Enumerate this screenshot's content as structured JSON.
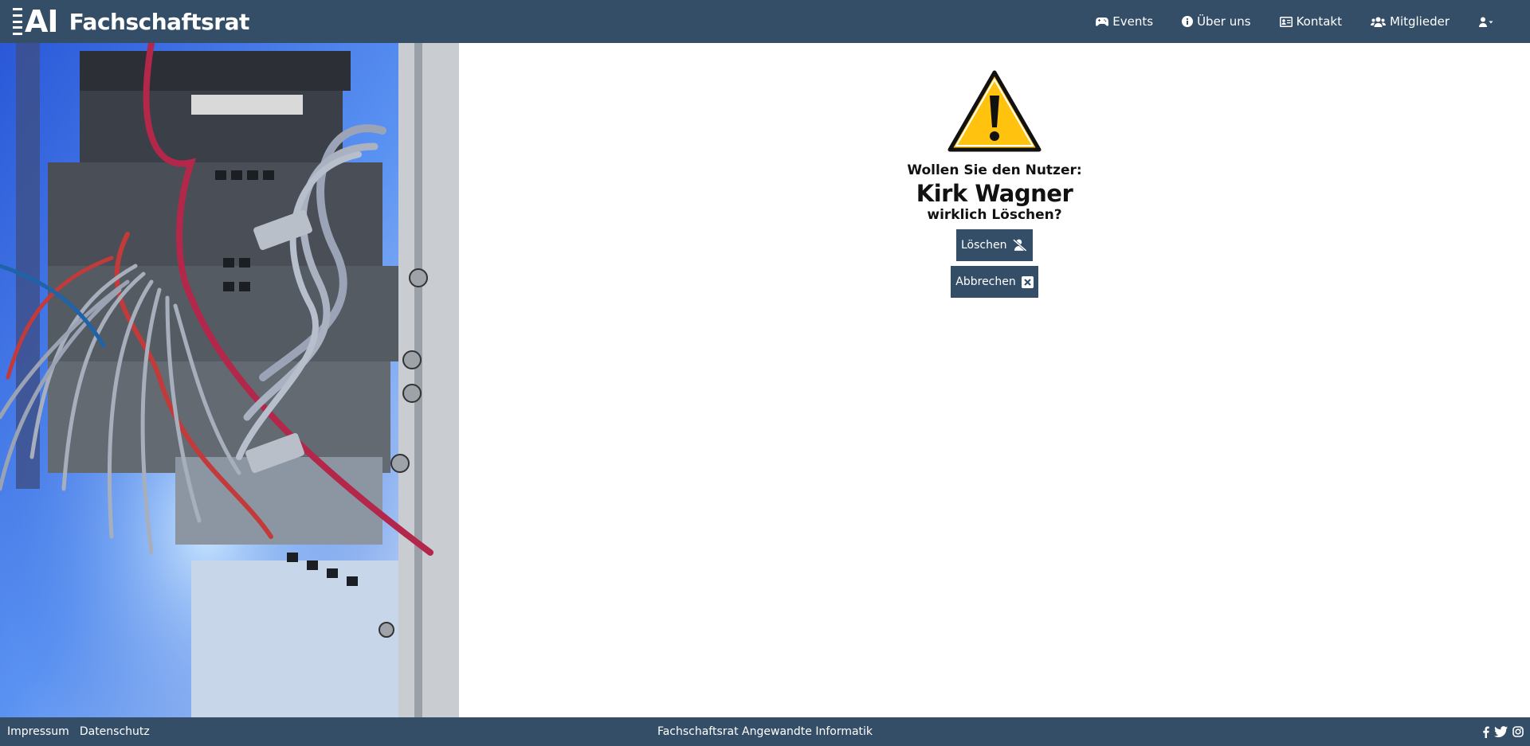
{
  "brand": {
    "logo_text": "AI",
    "title": "Fachschaftsrat"
  },
  "nav": {
    "items": [
      {
        "label": "Events",
        "icon": "gamepad-icon"
      },
      {
        "label": "Über uns",
        "icon": "info-circle-icon"
      },
      {
        "label": "Kontakt",
        "icon": "contact-card-icon"
      },
      {
        "label": "Mitglieder",
        "icon": "users-icon"
      }
    ],
    "user_menu_icon": "user-dropdown-icon"
  },
  "hero": {
    "image": "network-rack-photo"
  },
  "dialog": {
    "question": "Wollen Sie den Nutzer:",
    "username": "Kirk Wagner",
    "question_end": "wirklich Löschen?",
    "delete_label": "Löschen",
    "cancel_label": "Abbrechen"
  },
  "footer": {
    "impressum": "Impressum",
    "datenschutz": "Datenschutz",
    "center_text": "Fachschaftsrat Angewandte Informatik",
    "social": [
      "facebook-icon",
      "twitter-icon",
      "instagram-icon"
    ]
  },
  "colors": {
    "primary": "#344e68",
    "warning_yellow": "#ffc20e"
  }
}
